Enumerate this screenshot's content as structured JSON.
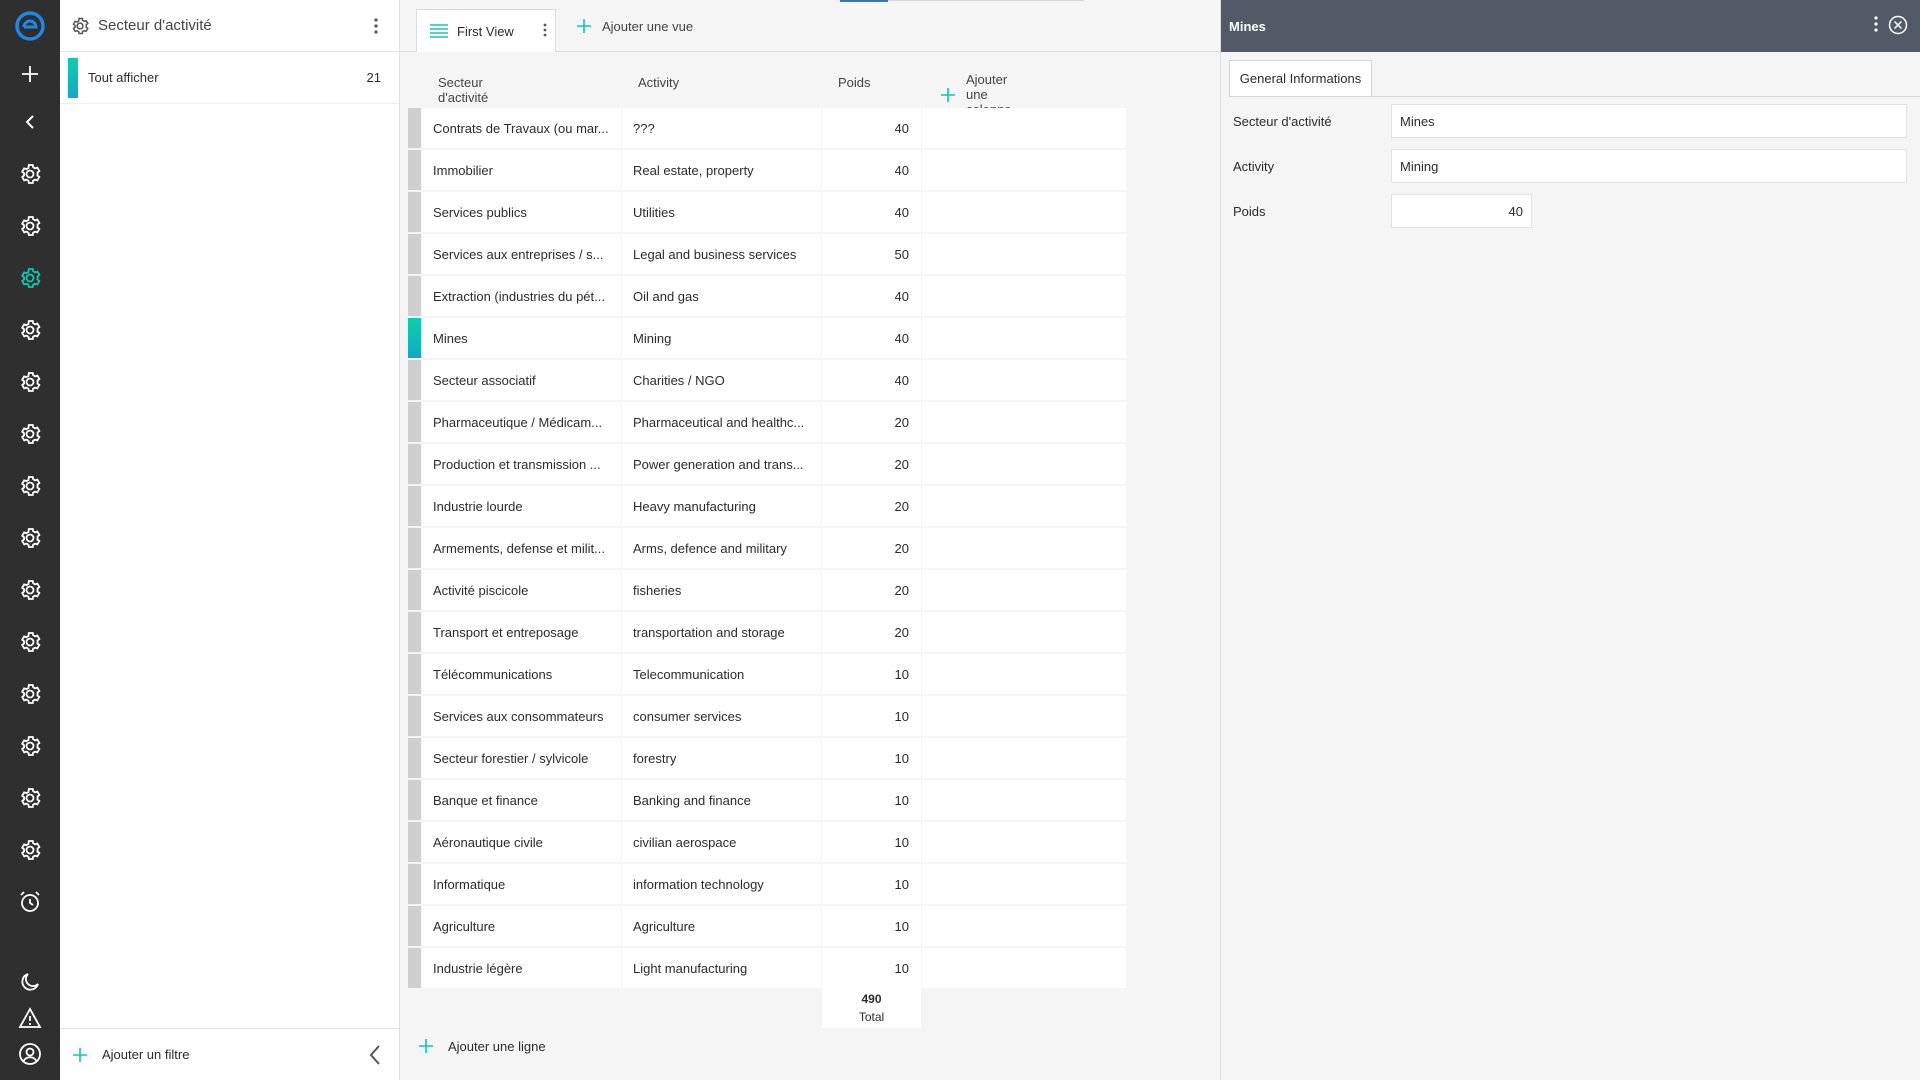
{
  "filter_panel": {
    "title": "Secteur d'activité",
    "items": [
      {
        "label": "Tout afficher",
        "count": "21"
      }
    ],
    "add_filter_label": "Ajouter un filtre"
  },
  "view": {
    "tab_label": "First View",
    "add_view_label": "Ajouter une vue",
    "columns": [
      "Secteur d'activité",
      "Activity",
      "Poids"
    ],
    "add_column_label": "Ajouter une colonne",
    "rows": [
      {
        "secteur": "Contrats de Travaux (ou mar...",
        "activity": "???",
        "poids": "40"
      },
      {
        "secteur": "Immobilier",
        "activity": "Real estate, property",
        "poids": "40"
      },
      {
        "secteur": "Services publics",
        "activity": "Utilities",
        "poids": "40"
      },
      {
        "secteur": "Services aux entreprises  / s...",
        "activity": "Legal and business services",
        "poids": "50"
      },
      {
        "secteur": "Extraction (industries du pét...",
        "activity": "Oil and gas",
        "poids": "40"
      },
      {
        "secteur": "Mines",
        "activity": "Mining",
        "poids": "40",
        "selected": true
      },
      {
        "secteur": "Secteur associatif",
        "activity": "Charities / NGO",
        "poids": "40"
      },
      {
        "secteur": "Pharmaceutique / Médicam...",
        "activity": "Pharmaceutical and healthc...",
        "poids": "20"
      },
      {
        "secteur": "Production et transmission ...",
        "activity": "Power generation and trans...",
        "poids": "20"
      },
      {
        "secteur": "Industrie lourde",
        "activity": "Heavy manufacturing",
        "poids": "20"
      },
      {
        "secteur": "Armements, defense et milit...",
        "activity": "Arms, defence and military",
        "poids": "20"
      },
      {
        "secteur": "Activité piscicole",
        "activity": "fisheries",
        "poids": "20"
      },
      {
        "secteur": "Transport et entreposage",
        "activity": "transportation and storage",
        "poids": "20"
      },
      {
        "secteur": "Télécommunications",
        "activity": "Telecommunication",
        "poids": "10"
      },
      {
        "secteur": "Services aux consommateurs",
        "activity": "consumer services",
        "poids": "10"
      },
      {
        "secteur": "Secteur forestier / sylvicole",
        "activity": "forestry",
        "poids": "10"
      },
      {
        "secteur": "Banque et finance",
        "activity": "Banking and finance",
        "poids": "10"
      },
      {
        "secteur": "Aéronautique civile",
        "activity": "civilian aerospace",
        "poids": "10"
      },
      {
        "secteur": "Informatique",
        "activity": "information technology",
        "poids": "10"
      },
      {
        "secteur": "Agriculture",
        "activity": "Agriculture",
        "poids": "10"
      },
      {
        "secteur": "Industrie légère",
        "activity": "Light manufacturing",
        "poids": "10"
      }
    ],
    "total_value": "490",
    "total_label": "Total",
    "add_row_label": "Ajouter une ligne"
  },
  "detail": {
    "title": "Mines",
    "tab_label": "General Informations",
    "fields": [
      {
        "label": "Secteur d'activité",
        "value": "Mines"
      },
      {
        "label": "Activity",
        "value": "Mining"
      },
      {
        "label": "Poids",
        "value": "40"
      }
    ]
  },
  "rail": {
    "icons": [
      "logo-icon",
      "plus-icon",
      "chevron-left-icon",
      "gear-icon",
      "moon-icon",
      "warning-icon",
      "user-icon",
      "alarm-icon"
    ],
    "active_gear_index": 3
  },
  "colors": {
    "accent": "#12c7b0",
    "rail_bg": "#2f2f2f",
    "detail_header_bg": "#525a67",
    "logo_blue": "#1e88e5"
  }
}
